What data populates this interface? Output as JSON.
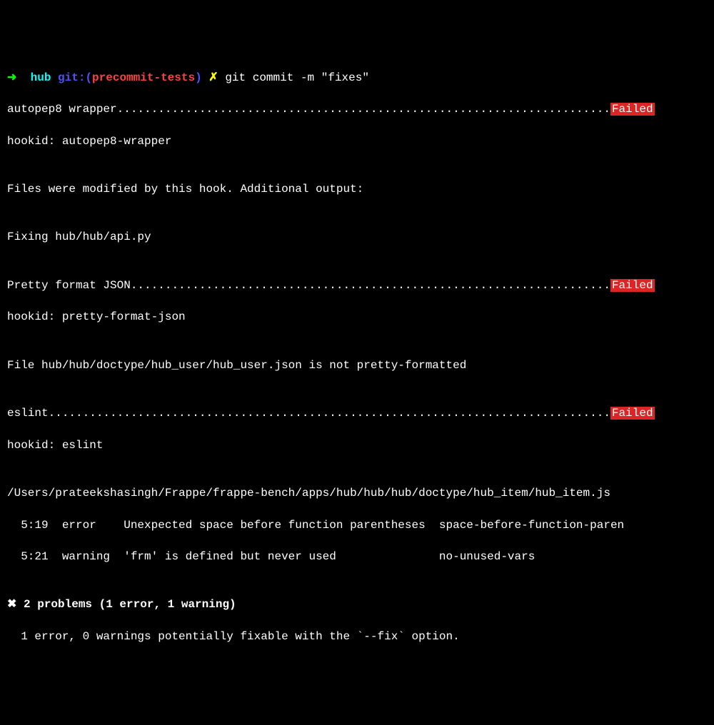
{
  "prompt": {
    "arrow": "➜",
    "dir": "hub",
    "git_label": "git:(",
    "branch": "precommit-tests",
    "git_close": ")",
    "x": "✗",
    "command": "git commit -m \"fixes\""
  },
  "hooks": [
    {
      "name": "autopep8 wrapper",
      "dots": "........................................................................",
      "status": "Failed",
      "hookid_label": "hookid: ",
      "hookid": "autopep8-wrapper",
      "blank1": "",
      "msg1": "Files were modified by this hook. Additional output:",
      "blank2": "",
      "msg2": "Fixing hub/hub/api.py",
      "blank3": ""
    },
    {
      "name": "Pretty format JSON",
      "dots": "......................................................................",
      "status": "Failed",
      "hookid_label": "hookid: ",
      "hookid": "pretty-format-json",
      "blank1": "",
      "msg1": "File hub/hub/doctype/hub_user/hub_user.json is not pretty-formatted",
      "blank2": ""
    },
    {
      "name": "eslint",
      "dots": "..................................................................................",
      "status": "Failed",
      "hookid_label": "hookid: ",
      "hookid": "eslint",
      "blank1": "",
      "file": "/Users/prateekshasingh/Frappe/frappe-bench/apps/hub/hub/hub/doctype/hub_item/hub_item.js",
      "err1": "  5:19  error    Unexpected space before function parentheses  space-before-function-paren",
      "err2": "  5:21  warning  'frm' is defined but never used               no-unused-vars",
      "blank2": "",
      "summary_x": "✖",
      "summary": " 2 problems (1 error, 1 warning)",
      "fixmsg": "  1 error, 0 warnings potentially fixable with the `--fix` option."
    }
  ]
}
